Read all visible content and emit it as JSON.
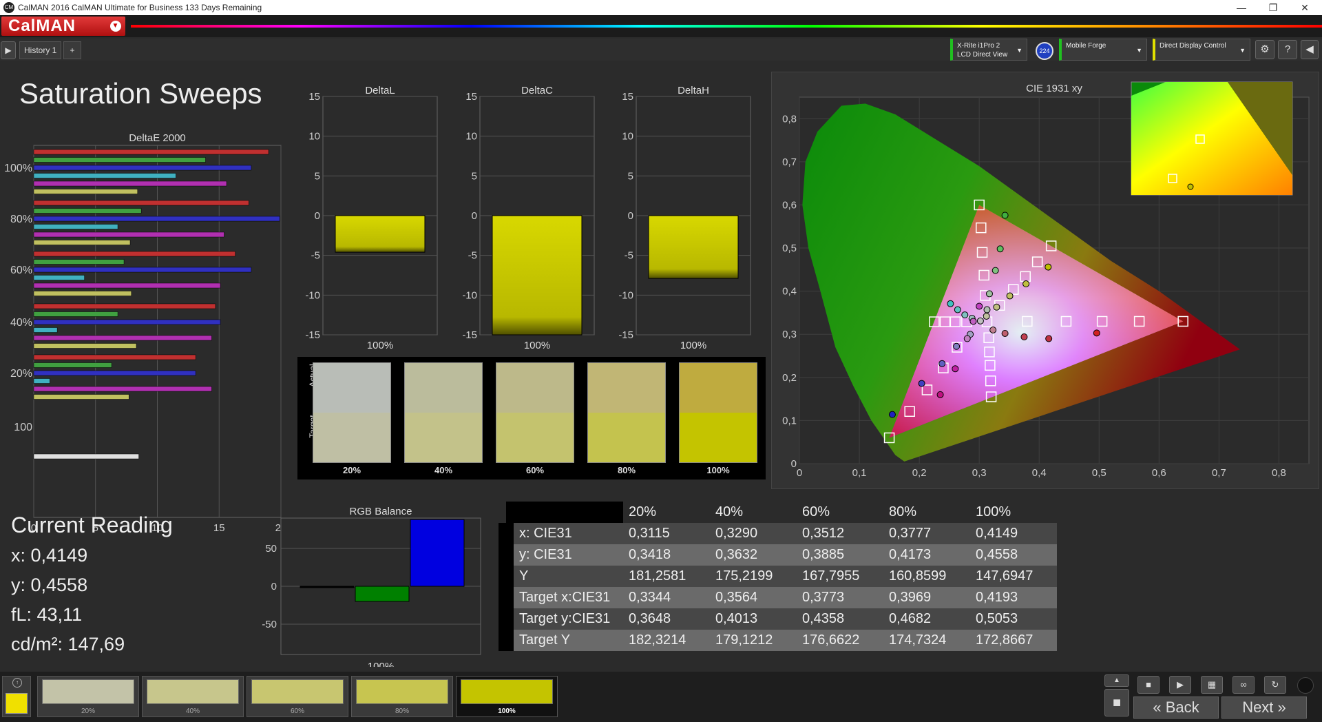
{
  "window": {
    "title": "CalMAN 2016 CalMAN Ultimate for Business 133 Days Remaining",
    "minimize": "—",
    "maximize": "❐",
    "close": "✕"
  },
  "app": {
    "logo": "CalMAN"
  },
  "tabs": [
    {
      "label": "History 1"
    }
  ],
  "devices": {
    "meter_line1": "X-Rite i1Pro 2",
    "meter_line2": "LCD Direct View",
    "meter_badge": "224",
    "source": "Mobile Forge",
    "display": "Direct Display Control"
  },
  "page": {
    "title": "Saturation Sweeps",
    "current_reading_title": "Current Reading",
    "x_line": "x: 0,4149",
    "y_line": "y: 0,4558",
    "fl_line": "fL: 43,11",
    "cd_line": "cd/m²: 147,69"
  },
  "colors": {
    "target_yellow": "#c4c400",
    "blue": "#0000e0",
    "green": "#008000",
    "red": "#c00000"
  },
  "chart_data": [
    {
      "type": "bar",
      "orientation": "horizontal",
      "title": "DeltaE 2000",
      "xlim": [
        0,
        20
      ],
      "xticks": [
        "0",
        "5",
        "10",
        "15",
        "20"
      ],
      "categories": [
        "100%",
        "80%",
        "60%",
        "40%",
        "20%",
        "100"
      ],
      "series": [
        {
          "color": "#c03030",
          "values": [
            19.0,
            17.4,
            16.3,
            14.7,
            13.1,
            null
          ]
        },
        {
          "color": "#40a040",
          "values": [
            13.9,
            8.7,
            7.3,
            6.8,
            6.3,
            null
          ]
        },
        {
          "color": "#3030c0",
          "values": [
            17.6,
            19.9,
            17.6,
            15.1,
            13.1,
            null
          ]
        },
        {
          "color": "#40b0c0",
          "values": [
            11.5,
            6.8,
            4.1,
            1.9,
            1.3,
            null
          ]
        },
        {
          "color": "#b030b0",
          "values": [
            15.6,
            15.4,
            15.1,
            14.4,
            14.4,
            null
          ]
        },
        {
          "color": "#c0c060",
          "values": [
            8.4,
            7.8,
            7.9,
            8.3,
            7.7,
            null
          ]
        },
        {
          "color": "#e0e0e0",
          "values": [
            null,
            null,
            null,
            null,
            null,
            8.5
          ]
        }
      ]
    },
    {
      "type": "bar",
      "title": "DeltaL",
      "ylim": [
        -15,
        15
      ],
      "yticks": [
        "15",
        "10",
        "5",
        "0",
        "-5",
        "-10",
        "-15"
      ],
      "categories": [
        "100%"
      ],
      "values": [
        -4.6
      ]
    },
    {
      "type": "bar",
      "title": "DeltaC",
      "ylim": [
        -15,
        15
      ],
      "yticks": [
        "15",
        "10",
        "5",
        "0",
        "-5",
        "-10",
        "-15"
      ],
      "categories": [
        "100%"
      ],
      "values": [
        -15
      ]
    },
    {
      "type": "bar",
      "title": "DeltaH",
      "ylim": [
        -15,
        15
      ],
      "yticks": [
        "15",
        "10",
        "5",
        "0",
        "-5",
        "-10",
        "-15"
      ],
      "categories": [
        "100%"
      ],
      "values": [
        -7.9
      ]
    },
    {
      "type": "scatter",
      "title": "CIE 1931 xy",
      "xlim": [
        0,
        0.85
      ],
      "ylim": [
        0,
        0.85
      ],
      "xticks": [
        "0",
        "0,1",
        "0,2",
        "0,3",
        "0,4",
        "0,5",
        "0,6",
        "0,7",
        "0,8"
      ],
      "yticks": [
        "0",
        "0,1",
        "0,2",
        "0,3",
        "0,4",
        "0,5",
        "0,6",
        "0,7",
        "0,8"
      ],
      "targets": [
        [
          0.64,
          0.33
        ],
        [
          0.567,
          0.33
        ],
        [
          0.505,
          0.33
        ],
        [
          0.445,
          0.33
        ],
        [
          0.38,
          0.33
        ],
        [
          0.3,
          0.6
        ],
        [
          0.303,
          0.547
        ],
        [
          0.305,
          0.49
        ],
        [
          0.308,
          0.437
        ],
        [
          0.31,
          0.39
        ],
        [
          0.15,
          0.06
        ],
        [
          0.184,
          0.121
        ],
        [
          0.213,
          0.171
        ],
        [
          0.24,
          0.222
        ],
        [
          0.263,
          0.27
        ],
        [
          0.225,
          0.329
        ],
        [
          0.243,
          0.329
        ],
        [
          0.26,
          0.329
        ],
        [
          0.279,
          0.329
        ],
        [
          0.42,
          0.505
        ],
        [
          0.397,
          0.468
        ],
        [
          0.377,
          0.434
        ],
        [
          0.357,
          0.404
        ],
        [
          0.334,
          0.367
        ],
        [
          0.32,
          0.155
        ],
        [
          0.319,
          0.192
        ],
        [
          0.318,
          0.228
        ],
        [
          0.317,
          0.259
        ],
        [
          0.316,
          0.292
        ],
        [
          0.313,
          0.329
        ]
      ],
      "measured": [
        {
          "x": 0.496,
          "y": 0.303,
          "c": "#d02020"
        },
        {
          "x": 0.416,
          "y": 0.29,
          "c": "#c03040"
        },
        {
          "x": 0.375,
          "y": 0.294,
          "c": "#c04050"
        },
        {
          "x": 0.343,
          "y": 0.302,
          "c": "#c06070"
        },
        {
          "x": 0.323,
          "y": 0.31,
          "c": "#c08090"
        },
        {
          "x": 0.343,
          "y": 0.576,
          "c": "#40b040"
        },
        {
          "x": 0.335,
          "y": 0.498,
          "c": "#60c060"
        },
        {
          "x": 0.327,
          "y": 0.448,
          "c": "#80c080"
        },
        {
          "x": 0.317,
          "y": 0.394,
          "c": "#a0c0a0"
        },
        {
          "x": 0.313,
          "y": 0.357,
          "c": "#b0c0b0"
        },
        {
          "x": 0.155,
          "y": 0.114,
          "c": "#2020c0"
        },
        {
          "x": 0.204,
          "y": 0.186,
          "c": "#4040c0"
        },
        {
          "x": 0.238,
          "y": 0.232,
          "c": "#6060c0"
        },
        {
          "x": 0.262,
          "y": 0.272,
          "c": "#8080c0"
        },
        {
          "x": 0.285,
          "y": 0.3,
          "c": "#a0a0c0"
        },
        {
          "x": 0.252,
          "y": 0.371,
          "c": "#40c0c0"
        },
        {
          "x": 0.264,
          "y": 0.357,
          "c": "#60c0c0"
        },
        {
          "x": 0.276,
          "y": 0.345,
          "c": "#80c0c0"
        },
        {
          "x": 0.288,
          "y": 0.337,
          "c": "#a0c0c0"
        },
        {
          "x": 0.302,
          "y": 0.331,
          "c": "#c0c0c0"
        },
        {
          "x": 0.415,
          "y": 0.456,
          "c": "#c0c000"
        },
        {
          "x": 0.378,
          "y": 0.417,
          "c": "#c0c040"
        },
        {
          "x": 0.351,
          "y": 0.389,
          "c": "#c0c060"
        },
        {
          "x": 0.329,
          "y": 0.363,
          "c": "#c0c080"
        },
        {
          "x": 0.312,
          "y": 0.342,
          "c": "#c0c0a0"
        },
        {
          "x": 0.3,
          "y": 0.365,
          "c": "#c040c0"
        },
        {
          "x": 0.29,
          "y": 0.33,
          "c": "#c060c0"
        },
        {
          "x": 0.28,
          "y": 0.29,
          "c": "#c080c0"
        },
        {
          "x": 0.26,
          "y": 0.22,
          "c": "#c020a0"
        },
        {
          "x": 0.235,
          "y": 0.16,
          "c": "#c01080"
        }
      ]
    },
    {
      "type": "bar",
      "title": "RGB Balance",
      "ylim": [
        -90,
        90
      ],
      "yticks": [
        "50",
        "0",
        "-50"
      ],
      "categories": [
        "100%"
      ],
      "series": [
        {
          "color": "#000000",
          "values": [
            -1
          ]
        },
        {
          "color": "#008000",
          "values": [
            -20
          ]
        },
        {
          "color": "#0000e0",
          "values": [
            88
          ]
        }
      ]
    }
  ],
  "swatches": [
    {
      "label": "20%",
      "actual": "#b9bdb7",
      "target": "#bfbfa4"
    },
    {
      "label": "40%",
      "actual": "#bbbc9c",
      "target": "#c3c28a"
    },
    {
      "label": "60%",
      "actual": "#bdb98a",
      "target": "#c4c36e"
    },
    {
      "label": "80%",
      "actual": "#c1b675",
      "target": "#c4c34e"
    },
    {
      "label": "100%",
      "actual": "#bfab3f",
      "target": "#c4c400"
    }
  ],
  "swatch_axis": {
    "actual": "Actual",
    "target": "Target"
  },
  "table": {
    "headers": [
      "",
      "20%",
      "40%",
      "60%",
      "80%",
      "100%"
    ],
    "rows": [
      [
        "x: CIE31",
        "0,3115",
        "0,3290",
        "0,3512",
        "0,3777",
        "0,4149"
      ],
      [
        "y: CIE31",
        "0,3418",
        "0,3632",
        "0,3885",
        "0,4173",
        "0,4558"
      ],
      [
        "Y",
        "181,2581",
        "175,2199",
        "167,7955",
        "160,8599",
        "147,6947"
      ],
      [
        "Target x:CIE31",
        "0,3344",
        "0,3564",
        "0,3773",
        "0,3969",
        "0,4193"
      ],
      [
        "Target y:CIE31",
        "0,3648",
        "0,4013",
        "0,4358",
        "0,4682",
        "0,5053"
      ],
      [
        "Target Y",
        "182,3214",
        "179,1212",
        "176,6622",
        "174,7324",
        "172,8667"
      ]
    ]
  },
  "bottom": {
    "patches": [
      {
        "label": "20%",
        "color": "#c3c3a8"
      },
      {
        "label": "40%",
        "color": "#c7c68c"
      },
      {
        "label": "60%",
        "color": "#c8c670"
      },
      {
        "label": "80%",
        "color": "#c7c550"
      },
      {
        "label": "100%",
        "color": "#c4c400"
      }
    ],
    "back": "Back",
    "next": "Next"
  }
}
